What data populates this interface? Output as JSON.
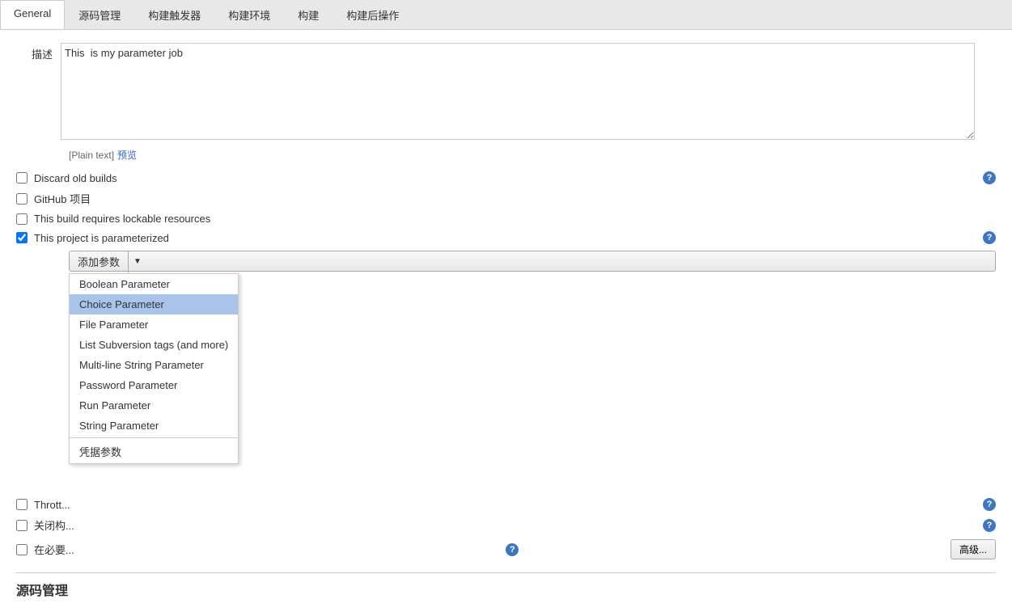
{
  "tabs": [
    {
      "id": "general",
      "label": "General",
      "active": true
    },
    {
      "id": "source",
      "label": "源码管理",
      "active": false
    },
    {
      "id": "trigger",
      "label": "构建触发器",
      "active": false
    },
    {
      "id": "env",
      "label": "构建环境",
      "active": false
    },
    {
      "id": "build",
      "label": "构建",
      "active": false
    },
    {
      "id": "postbuild",
      "label": "构建后操作",
      "active": false
    }
  ],
  "description": {
    "label": "描述",
    "value": "This  is my parameter job",
    "plain_text_label": "[Plain text]",
    "preview_label": "预览"
  },
  "checkboxes": [
    {
      "id": "discard-old-builds",
      "label": "Discard old builds",
      "checked": false,
      "has_help": true
    },
    {
      "id": "github-project",
      "label": "GitHub 项目",
      "checked": false,
      "has_help": false
    },
    {
      "id": "lockable-resources",
      "label": "This build requires lockable resources",
      "checked": false,
      "has_help": false
    },
    {
      "id": "parameterized",
      "label": "This project is parameterized",
      "checked": true,
      "has_help": true
    }
  ],
  "add_param_button": {
    "label": "添加参数",
    "arrow": "▼"
  },
  "dropdown_items": [
    {
      "label": "Boolean Parameter",
      "selected": false
    },
    {
      "label": "Choice Parameter",
      "selected": true
    },
    {
      "label": "File Parameter",
      "selected": false
    },
    {
      "label": "List Subversion tags (and more)",
      "selected": false
    },
    {
      "label": "Multi-line String Parameter",
      "selected": false
    },
    {
      "label": "Password Parameter",
      "selected": false
    },
    {
      "label": "Run Parameter",
      "selected": false
    },
    {
      "label": "String Parameter",
      "selected": false
    },
    {
      "label": "凭据参数",
      "selected": false,
      "divider_before": true
    }
  ],
  "extra_checkboxes": [
    {
      "id": "throttle",
      "label": "Thrott...",
      "checked": false,
      "has_help": true
    },
    {
      "id": "close",
      "label": "关闭构...",
      "checked": false,
      "has_help": true
    },
    {
      "id": "necessary",
      "label": "在必要...",
      "checked": false,
      "has_help": true
    }
  ],
  "advanced_button": {
    "label": "高级..."
  },
  "section_title": "源码管理",
  "help_icon_symbol": "?"
}
